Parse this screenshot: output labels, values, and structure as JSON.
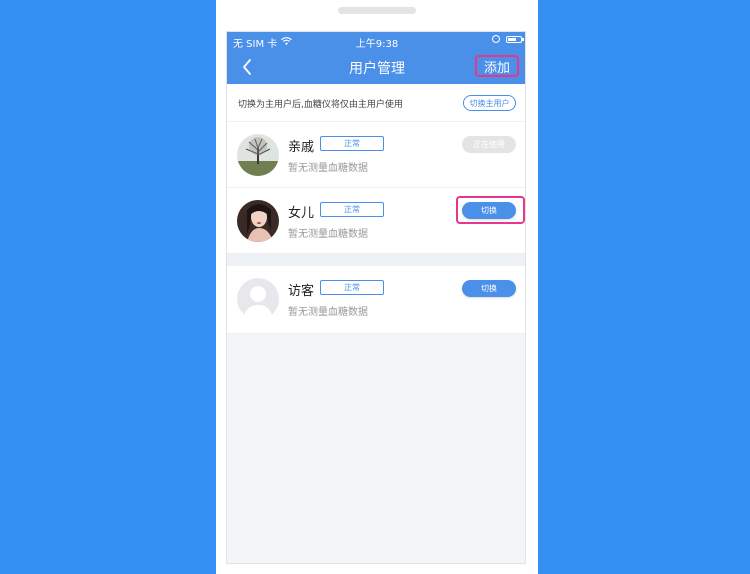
{
  "status_bar": {
    "carrier": "无 SIM 卡",
    "time": "上午9:38"
  },
  "nav": {
    "title": "用户管理",
    "add_label": "添加"
  },
  "hint": {
    "text": "切换为主用户后,血糖仪将仅由主用户使用",
    "switch_main_label": "切换主用户"
  },
  "users": [
    {
      "name": "亲戚",
      "status": "正常",
      "subtitle": "暂无测量血糖数据",
      "action": "正在使用",
      "avatar": "tree-photo"
    },
    {
      "name": "女儿",
      "status": "正常",
      "subtitle": "暂无测量血糖数据",
      "action": "切换",
      "avatar": "girl-photo"
    },
    {
      "name": "访客",
      "status": "正常",
      "subtitle": "暂无测量血糖数据",
      "action": "切换",
      "avatar": "default-avatar"
    }
  ],
  "colors": {
    "background": "#3590f4",
    "nav": "#4a8fe8",
    "highlight": "#e6368e"
  }
}
